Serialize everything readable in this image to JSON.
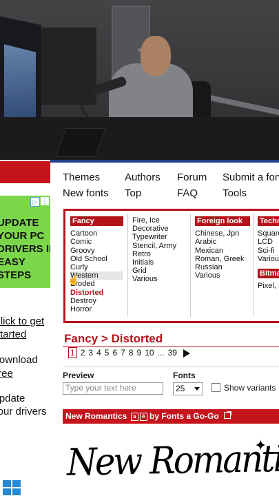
{
  "nav": {
    "row1": [
      "Themes",
      "Authors",
      "Forum",
      "Submit a font"
    ],
    "row2": [
      "New fonts",
      "Top",
      "FAQ",
      "Tools"
    ]
  },
  "categories": {
    "fancy": {
      "title": "Fancy",
      "items": [
        "Cartoon",
        "Comic",
        "Groovy",
        "Old School",
        "Curly",
        "Western",
        "Eroded",
        "Distorted",
        "Destroy",
        "Horror"
      ],
      "selected": "Distorted"
    },
    "fancy2": {
      "items": [
        "Fire, Ice",
        "Decorative",
        "Typewriter",
        "Stencil, Army",
        "Retro",
        "Initials",
        "Grid",
        "Various"
      ]
    },
    "foreign": {
      "title": "Foreign look",
      "items": [
        "Chinese, Jpn",
        "Arabic",
        "Mexican",
        "Roman, Greek",
        "Russian",
        "Various"
      ]
    },
    "techno": {
      "title": "Techno",
      "items": [
        "Square",
        "LCD",
        "Sci-fi",
        "Various"
      ]
    },
    "bitmap": {
      "title": "Bitmap",
      "items": [
        "Pixel, Bitmap"
      ]
    }
  },
  "breadcrumb": "Fancy > Distorted",
  "pager": {
    "current": "1",
    "pages": [
      "2",
      "3",
      "4",
      "5",
      "6",
      "7",
      "8",
      "9",
      "10",
      "...",
      "39"
    ]
  },
  "controls": {
    "preview_label": "Preview",
    "preview_placeholder": "Type your text here",
    "fonts_label": "Fonts",
    "fonts_size": "25",
    "variants_label": "Show variants"
  },
  "font_entry": {
    "name": "New Romantics",
    "badge1": "a",
    "badge2": "é",
    "by": "by Fonts a Go-Go",
    "sample": "New Romantics"
  },
  "ad": {
    "text_lines": [
      "UPDATE",
      "YOUR PC",
      "DRIVERS IN",
      "EASY STEPS"
    ],
    "choices_icon": "adchoices-icon",
    "close_icon": "ad-close-icon"
  },
  "left_links": {
    "click_to_get_started": [
      "Click to get",
      "Started"
    ],
    "download_free": [
      "Download",
      "Free"
    ],
    "update_drivers": [
      "Update",
      "Your drivers"
    ]
  },
  "colors": {
    "accent_red": "#b6121a",
    "ad_green": "#7cd64a",
    "nav_blue": "#1f3f8a"
  }
}
